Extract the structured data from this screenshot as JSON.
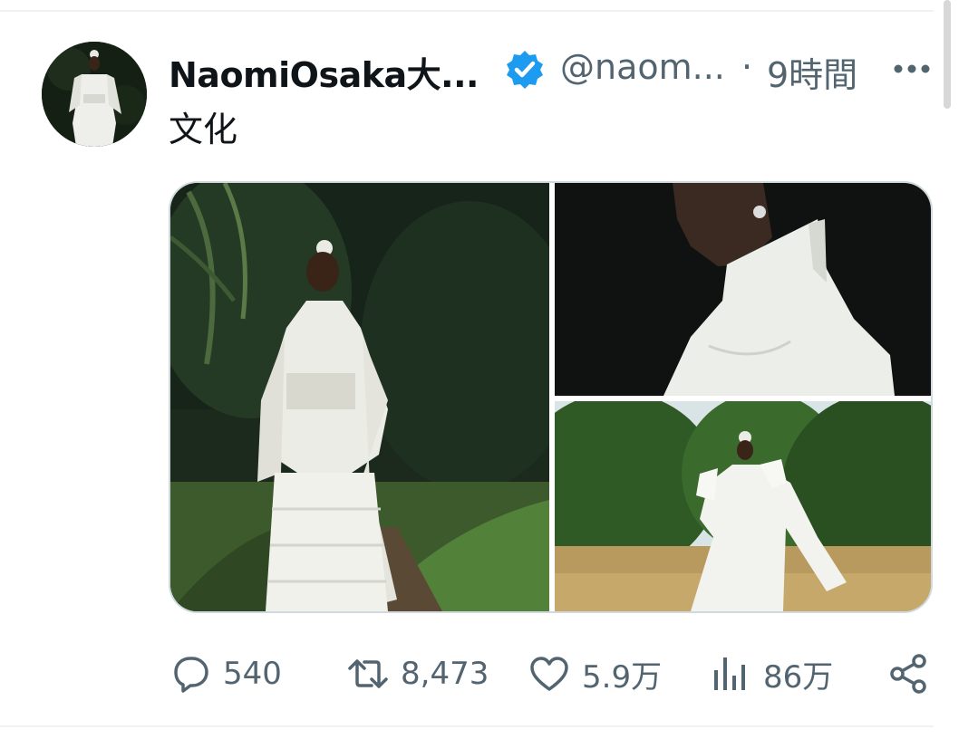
{
  "tweet": {
    "display_name": "NaomiOsaka大...",
    "handle": "@naom...",
    "separator": "·",
    "timestamp": "9時間",
    "text": "文化"
  },
  "actions": {
    "replies": "540",
    "retweets": "8,473",
    "likes": "5.9万",
    "views": "86万"
  },
  "colors": {
    "verified_badge": "#1d9bf0",
    "secondary_text": "#536471",
    "divider": "#eff3f4"
  },
  "icons": [
    "verified-badge-icon",
    "more-icon",
    "reply-icon",
    "retweet-icon",
    "like-icon",
    "views-icon",
    "share-icon"
  ]
}
